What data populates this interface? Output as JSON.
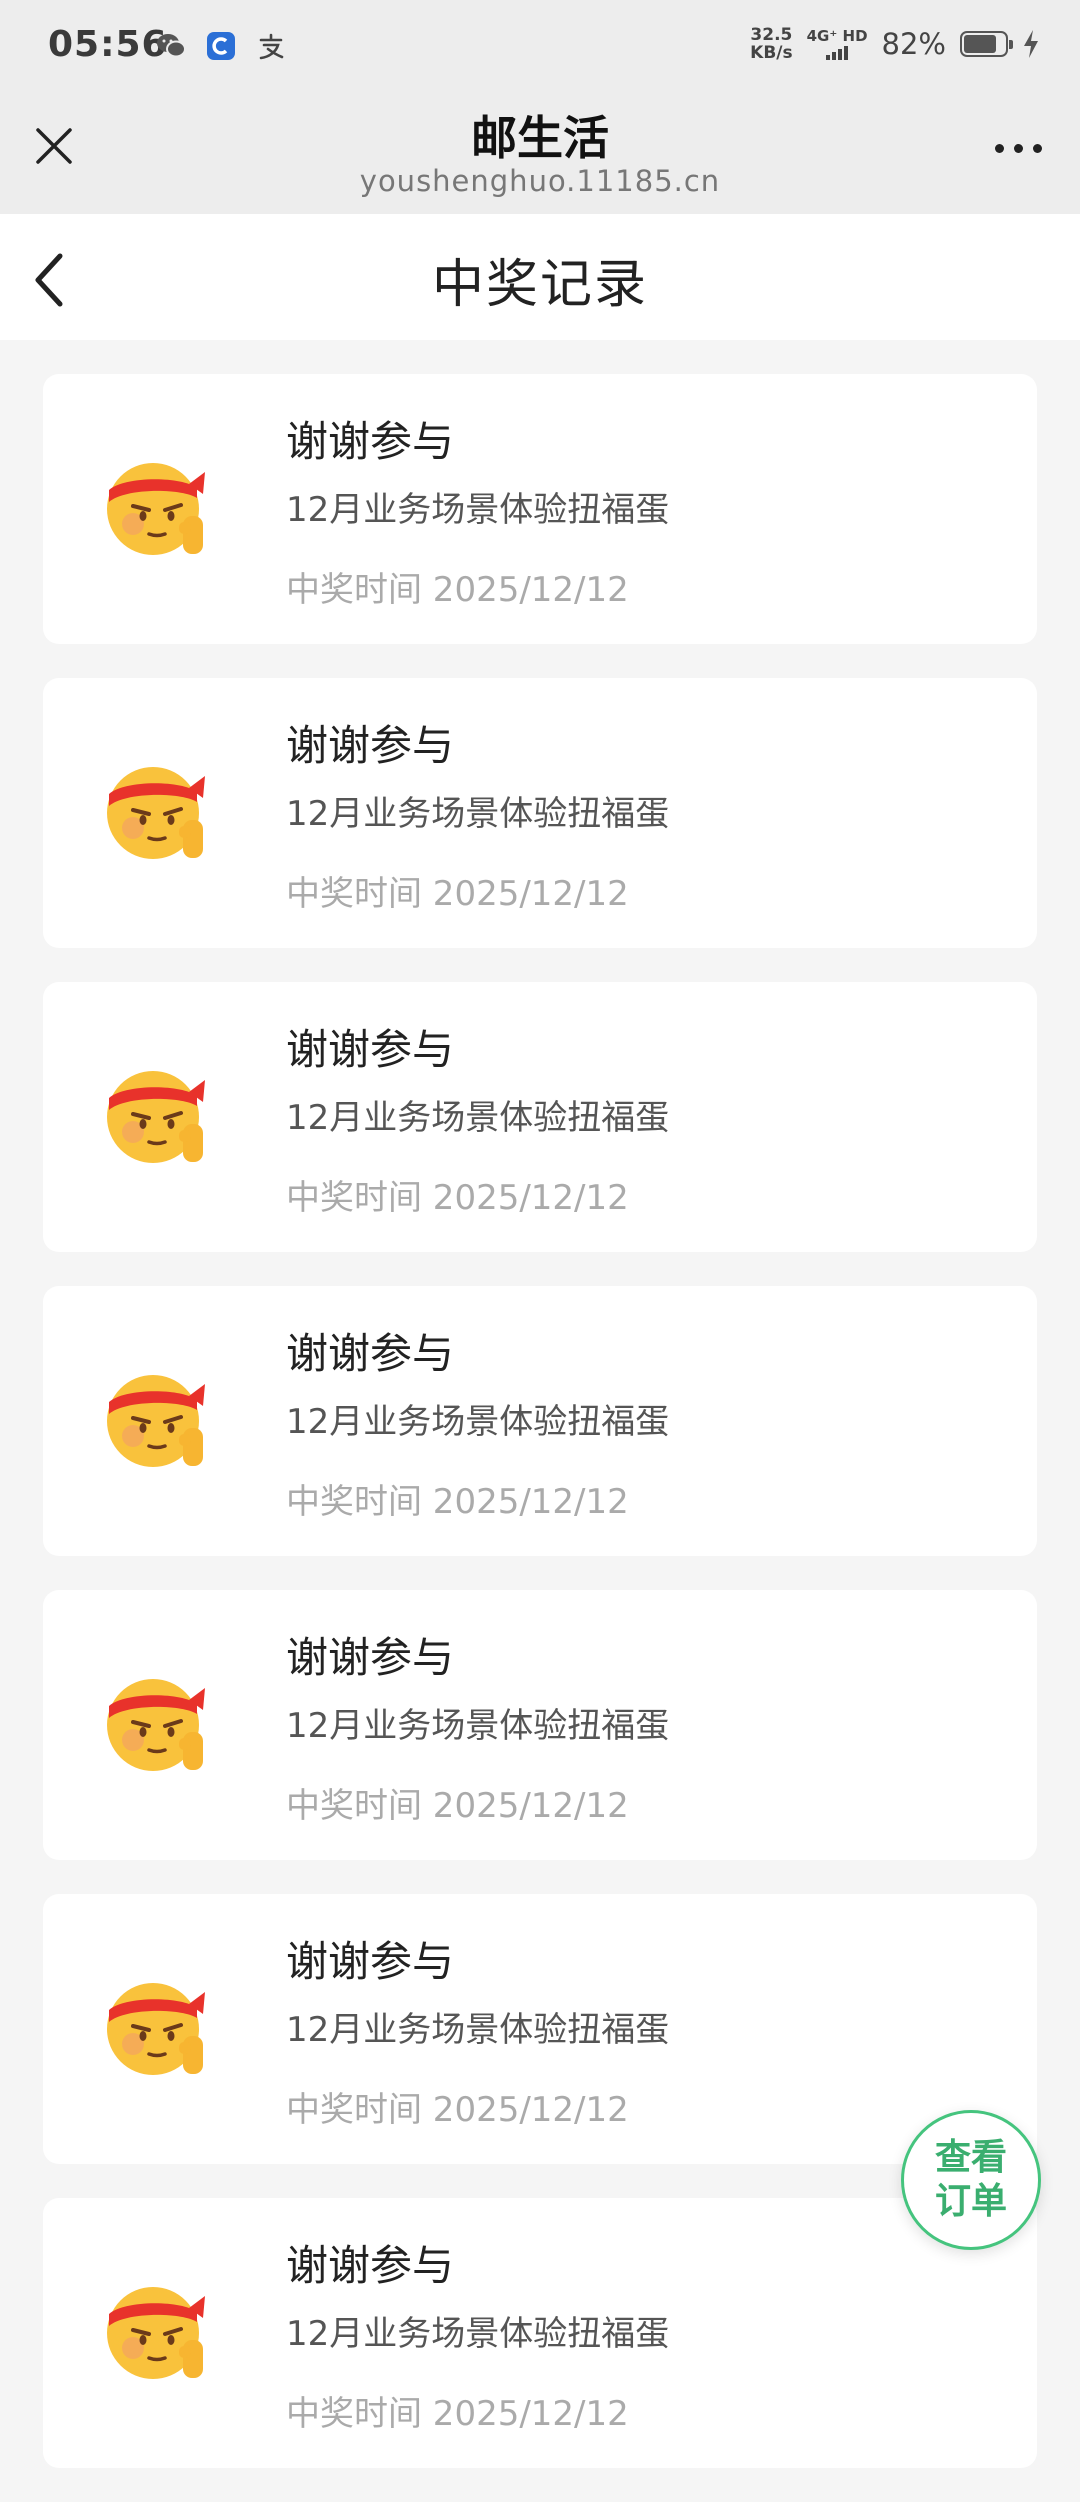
{
  "status_bar": {
    "time": "05:56",
    "net_speed_value": "32.5",
    "net_speed_unit": "KB/s",
    "network_type": "4G⁺ HD",
    "battery_percent": "82%",
    "battery_level": 0.82,
    "app_icons": [
      "wechat-icon",
      "browser-c-icon",
      "alipay-icon"
    ]
  },
  "mini_program": {
    "title": "邮生活",
    "url": "youshenghuo.11185.cn"
  },
  "page": {
    "title": "中奖记录"
  },
  "records": [
    {
      "prize": "谢谢参与",
      "activity": "12月业务场景体验扭福蛋",
      "time_label": "中奖时间 2025/12/12"
    },
    {
      "prize": "谢谢参与",
      "activity": "12月业务场景体验扭福蛋",
      "time_label": "中奖时间 2025/12/12"
    },
    {
      "prize": "谢谢参与",
      "activity": "12月业务场景体验扭福蛋",
      "time_label": "中奖时间 2025/12/12"
    },
    {
      "prize": "谢谢参与",
      "activity": "12月业务场景体验扭福蛋",
      "time_label": "中奖时间 2025/12/12"
    },
    {
      "prize": "谢谢参与",
      "activity": "12月业务场景体验扭福蛋",
      "time_label": "中奖时间 2025/12/12"
    },
    {
      "prize": "谢谢参与",
      "activity": "12月业务场景体验扭福蛋",
      "time_label": "中奖时间 2025/12/12"
    },
    {
      "prize": "谢谢参与",
      "activity": "12月业务场景体验扭福蛋",
      "time_label": "中奖时间 2025/12/12"
    }
  ],
  "float_button": {
    "line1": "查看",
    "line2": "订单"
  },
  "colors": {
    "accent_green": "#45c47e",
    "headband_red": "#e8322b",
    "emoji_yellow": "#f9c23c"
  }
}
